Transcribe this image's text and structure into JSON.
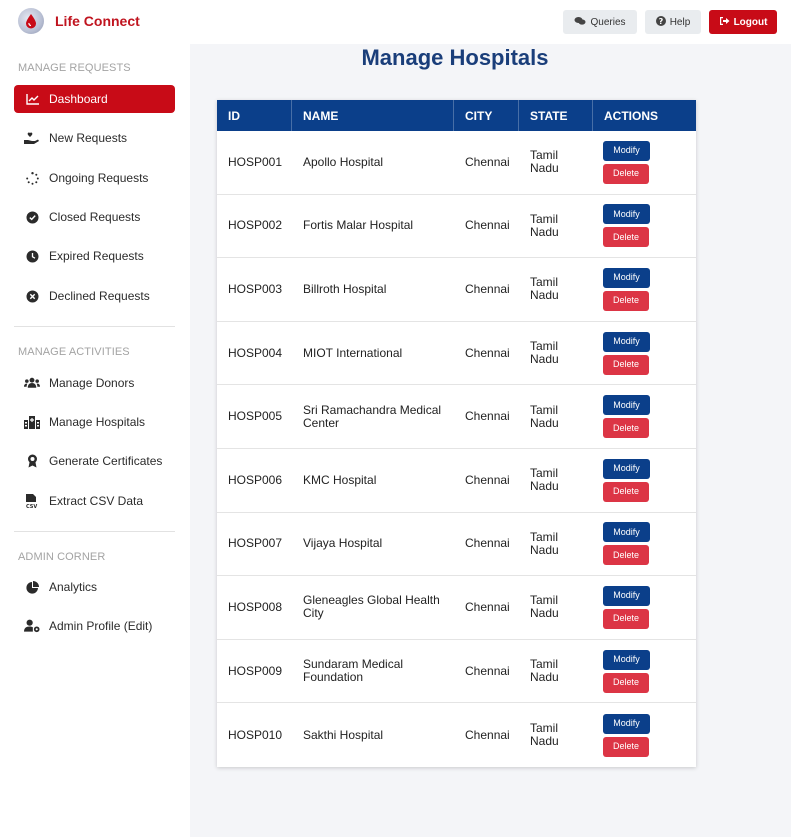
{
  "app": {
    "title": "Life Connect"
  },
  "topbar": {
    "queries_label": "Queries",
    "help_label": "Help",
    "logout_label": "Logout"
  },
  "sidebar": {
    "sections": [
      {
        "title": "MANAGE REQUESTS"
      },
      {
        "title": "MANAGE ACTIVITIES"
      },
      {
        "title": "ADMIN CORNER"
      }
    ],
    "items": [
      {
        "label": "Dashboard",
        "icon": "chart-line-icon",
        "active": true
      },
      {
        "label": "New Requests",
        "icon": "hand-heart-icon"
      },
      {
        "label": "Ongoing Requests",
        "icon": "spinner-icon"
      },
      {
        "label": "Closed Requests",
        "icon": "check-circle-icon"
      },
      {
        "label": "Expired Requests",
        "icon": "clock-icon"
      },
      {
        "label": "Declined Requests",
        "icon": "x-circle-icon"
      },
      {
        "label": "Manage Donors",
        "icon": "users-icon"
      },
      {
        "label": "Manage Hospitals",
        "icon": "hospital-icon"
      },
      {
        "label": "Generate Certificates",
        "icon": "award-icon"
      },
      {
        "label": "Extract CSV Data",
        "icon": "csv-file-icon"
      },
      {
        "label": "Analytics",
        "icon": "pie-chart-icon"
      },
      {
        "label": "Admin Profile (Edit)",
        "icon": "user-gear-icon"
      }
    ]
  },
  "main": {
    "title": "Manage Hospitals",
    "table": {
      "headers": [
        "ID",
        "NAME",
        "CITY",
        "STATE",
        "ACTIONS"
      ],
      "modify_label": "Modify",
      "delete_label": "Delete",
      "rows": [
        {
          "id": "HOSP001",
          "name": "Apollo Hospital",
          "city": "Chennai",
          "state": "Tamil Nadu"
        },
        {
          "id": "HOSP002",
          "name": "Fortis Malar Hospital",
          "city": "Chennai",
          "state": "Tamil Nadu"
        },
        {
          "id": "HOSP003",
          "name": "Billroth Hospital",
          "city": "Chennai",
          "state": "Tamil Nadu"
        },
        {
          "id": "HOSP004",
          "name": "MIOT International",
          "city": "Chennai",
          "state": "Tamil Nadu"
        },
        {
          "id": "HOSP005",
          "name": "Sri Ramachandra Medical Center",
          "city": "Chennai",
          "state": "Tamil Nadu"
        },
        {
          "id": "HOSP006",
          "name": "KMC Hospital",
          "city": "Chennai",
          "state": "Tamil Nadu"
        },
        {
          "id": "HOSP007",
          "name": "Vijaya Hospital",
          "city": "Chennai",
          "state": "Tamil Nadu"
        },
        {
          "id": "HOSP008",
          "name": "Gleneagles Global Health City",
          "city": "Chennai",
          "state": "Tamil Nadu"
        },
        {
          "id": "HOSP009",
          "name": "Sundaram Medical Foundation",
          "city": "Chennai",
          "state": "Tamil Nadu"
        },
        {
          "id": "HOSP010",
          "name": "Sakthi Hospital",
          "city": "Chennai",
          "state": "Tamil Nadu"
        }
      ]
    }
  },
  "colors": {
    "brand_red": "#c80b17",
    "header_blue": "#0b3f8a",
    "title_blue": "#1a3e7a",
    "delete_red": "#dc3545"
  }
}
